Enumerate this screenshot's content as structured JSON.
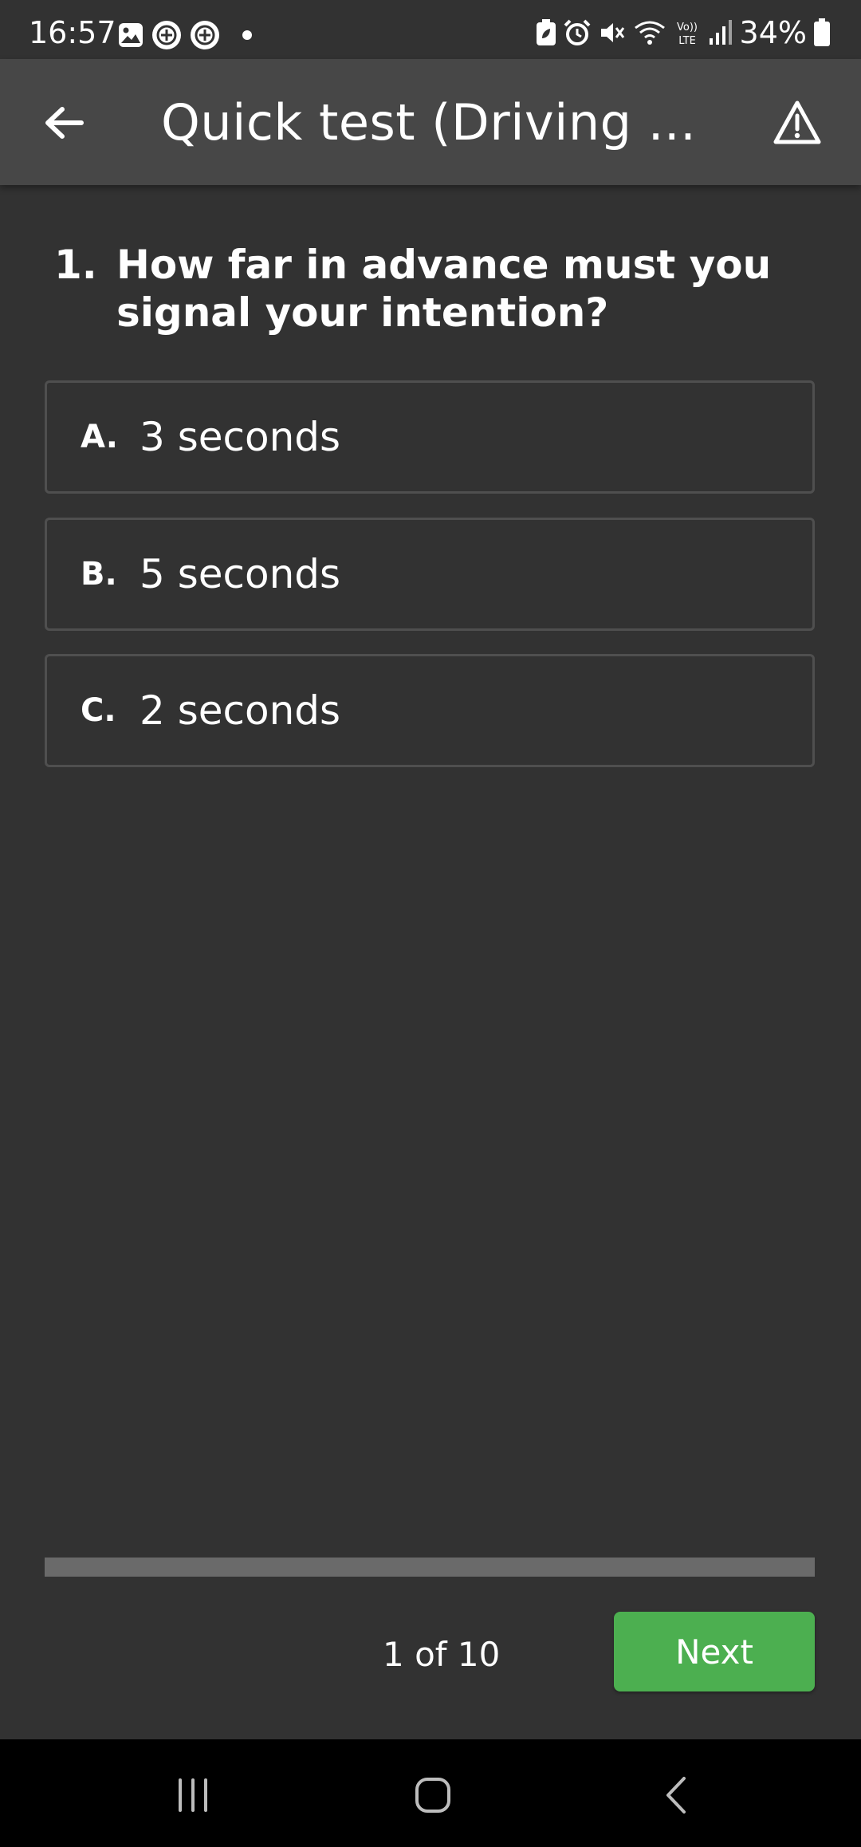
{
  "status_bar": {
    "time": "16:57",
    "battery_percent": "34%",
    "left_icons": [
      "gallery-icon",
      "app-notification-icon",
      "app-notification-icon",
      "dot-icon"
    ],
    "right_icons": [
      "battery-saver-icon",
      "alarm-icon",
      "mute-icon",
      "wifi-icon",
      "volte-icon",
      "signal-icon",
      "battery-icon"
    ]
  },
  "app_bar": {
    "title": "Quick test (Driving ...",
    "back_icon": "back-arrow-icon",
    "warning_icon": "warning-icon"
  },
  "question": {
    "number": "1.",
    "text": "How far in advance must you signal your intention?"
  },
  "options": [
    {
      "letter": "A.",
      "text": "3 seconds"
    },
    {
      "letter": "B.",
      "text": "5 seconds"
    },
    {
      "letter": "C.",
      "text": "2 seconds"
    }
  ],
  "progress": {
    "counter": "1 of 10",
    "fraction": 0.0
  },
  "actions": {
    "next_label": "Next"
  },
  "colors": {
    "background": "#323232",
    "app_bar": "#474747",
    "accent_green": "#4caf50",
    "option_border": "#4f4f4f",
    "progress_track": "#6a6a6a"
  },
  "nav_bar": {
    "icons": [
      "recent-apps-icon",
      "home-icon",
      "back-icon"
    ]
  }
}
